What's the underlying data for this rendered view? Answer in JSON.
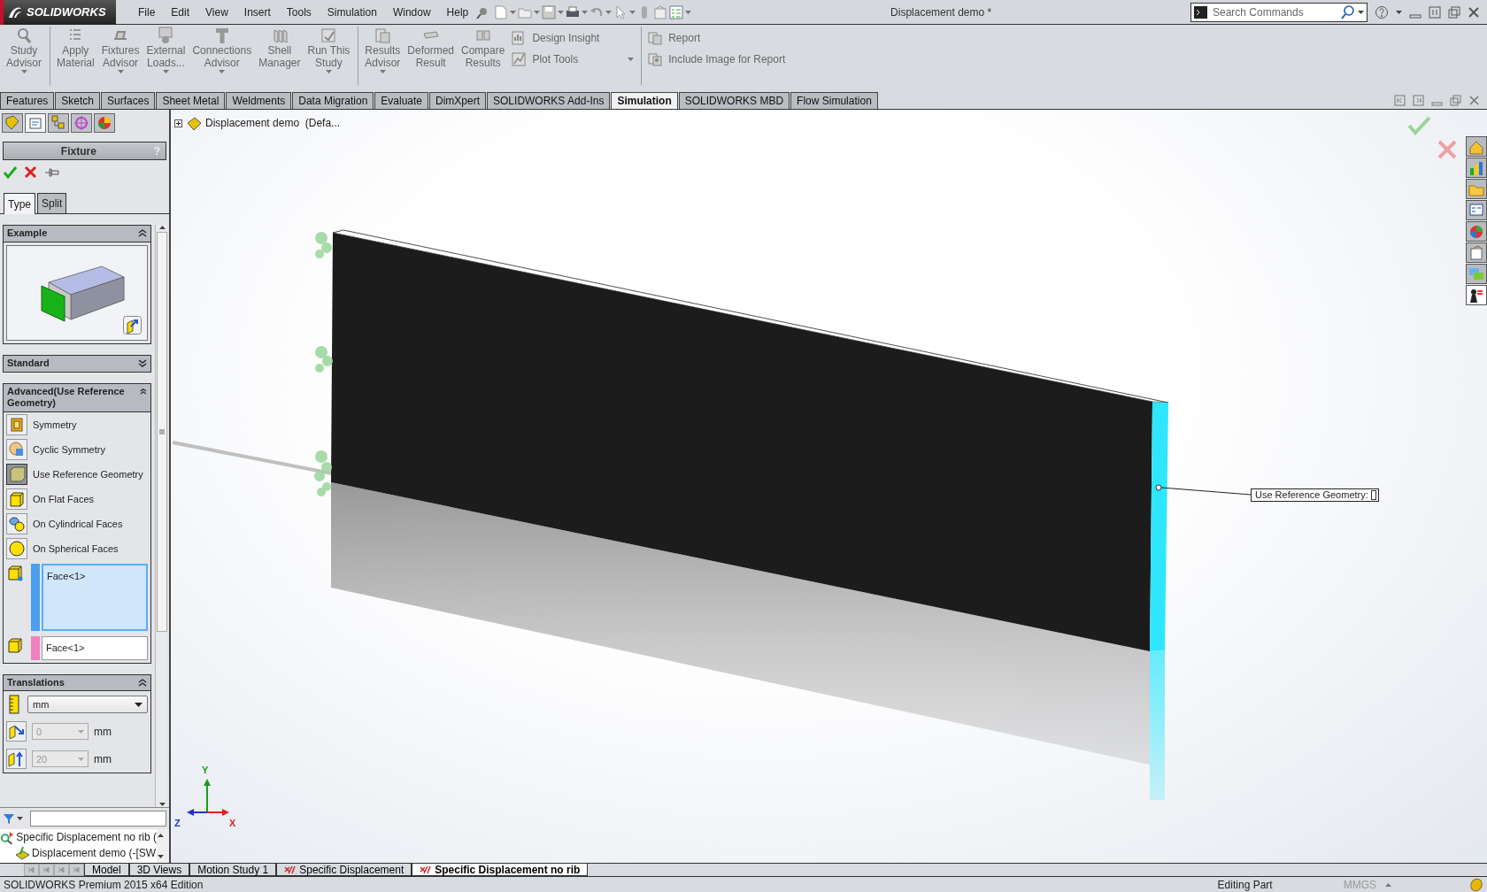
{
  "title_bar": {
    "logo": "SOLIDWORKS",
    "menus": [
      "File",
      "Edit",
      "View",
      "Insert",
      "Tools",
      "Simulation",
      "Window",
      "Help"
    ],
    "document_title": "Displacement demo *",
    "search": {
      "placeholder": "Search Commands"
    }
  },
  "ribbon": {
    "groups": [
      {
        "buttons": [
          {
            "label": "Study\nAdvisor",
            "dropdown": true
          }
        ]
      },
      {
        "buttons": [
          {
            "label": "Apply\nMaterial",
            "dropdown": false
          },
          {
            "label": "Fixtures\nAdvisor",
            "dropdown": true
          },
          {
            "label": "External\nLoads...",
            "dropdown": true
          },
          {
            "label": "Connections\nAdvisor",
            "dropdown": true
          },
          {
            "label": "Shell\nManager",
            "dropdown": false
          },
          {
            "label": "Run This\nStudy",
            "dropdown": true
          }
        ]
      },
      {
        "buttons": [
          {
            "label": "Results\nAdvisor",
            "dropdown": true
          },
          {
            "label": "Deformed\nResult",
            "dropdown": false
          },
          {
            "label": "Compare\nResults",
            "dropdown": false
          }
        ],
        "small_buttons": [
          {
            "label": "Design Insight",
            "dropdown": false
          },
          {
            "label": "Plot Tools",
            "dropdown": true
          }
        ]
      },
      {
        "small_buttons": [
          {
            "label": "Report",
            "dropdown": false
          },
          {
            "label": "Include Image for Report",
            "dropdown": false
          }
        ]
      }
    ]
  },
  "command_tabs": [
    {
      "label": "Features",
      "selected": false
    },
    {
      "label": "Sketch",
      "selected": false
    },
    {
      "label": "Surfaces",
      "selected": false
    },
    {
      "label": "Sheet Metal",
      "selected": false
    },
    {
      "label": "Weldments",
      "selected": false
    },
    {
      "label": "Data Migration",
      "selected": false
    },
    {
      "label": "Evaluate",
      "selected": false
    },
    {
      "label": "DimXpert",
      "selected": false
    },
    {
      "label": "SOLIDWORKS Add-Ins",
      "selected": false
    },
    {
      "label": "Simulation",
      "selected": true
    },
    {
      "label": "SOLIDWORKS MBD",
      "selected": false
    },
    {
      "label": "Flow Simulation",
      "selected": false
    }
  ],
  "property_manager": {
    "panel_tabs": [
      {
        "selected": false
      },
      {
        "selected": true
      },
      {
        "selected": false
      },
      {
        "selected": false
      },
      {
        "selected": false
      }
    ],
    "title": "Fixture",
    "help_glyph": "?",
    "type_tabs": [
      {
        "label": "Type",
        "selected": true
      },
      {
        "label": "Split",
        "selected": false
      }
    ],
    "sections": [
      {
        "kind": "example",
        "title": "Example",
        "expanded": true
      },
      {
        "kind": "group",
        "title": "Standard",
        "expanded": false
      },
      {
        "kind": "options",
        "title": "Advanced(Use Reference Geometry)",
        "expanded": true,
        "options": [
          {
            "label": "Symmetry",
            "selected": false
          },
          {
            "label": "Cyclic Symmetry",
            "selected": false
          },
          {
            "label": "Use Reference Geometry",
            "selected": true
          },
          {
            "label": "On Flat Faces",
            "selected": false
          },
          {
            "label": "On Cylindrical Faces",
            "selected": false
          },
          {
            "label": "On Spherical Faces",
            "selected": false
          }
        ],
        "selection_boxes": [
          {
            "items": [
              "Face<1>"
            ],
            "color": "#4a9ff0",
            "active": true
          },
          {
            "items": [
              "Face<1>"
            ],
            "color": "#f080c0",
            "active": false
          }
        ]
      },
      {
        "kind": "translations",
        "title": "Translations",
        "expanded": true,
        "unit": "mm",
        "fields": [
          {
            "value": "0",
            "unit": "mm",
            "disabled": true
          },
          {
            "value": "20",
            "unit": "mm",
            "disabled": true
          }
        ]
      }
    ]
  },
  "sim_tree": [
    {
      "label": "Specific Displacement no rib (",
      "children": [
        {
          "label": "Displacement demo (-[SW"
        }
      ]
    }
  ],
  "task_pane_tabs": [
    {
      "selected": false
    },
    {
      "selected": false
    },
    {
      "selected": false
    },
    {
      "selected": false
    },
    {
      "selected": false
    },
    {
      "selected": false
    },
    {
      "selected": false
    },
    {
      "selected": true
    }
  ],
  "viewport": {
    "tree_root": "Displacement demo  (Defa...",
    "callout": "Use Reference Geometry:",
    "axes": {
      "x": "X",
      "y": "Y",
      "z": "Z"
    }
  },
  "bottom_tabs": [
    {
      "label": "Model",
      "selected": false
    },
    {
      "label": "3D Views",
      "selected": false
    },
    {
      "label": "Motion Study 1",
      "selected": false
    },
    {
      "label": "Specific Displacement",
      "selected": false
    },
    {
      "label": "Specific Displacement no rib",
      "selected": true
    }
  ],
  "status_bar": {
    "edition": "SOLIDWORKS Premium 2015 x64 Edition",
    "mode": "Editing Part",
    "units": "MMGS"
  }
}
